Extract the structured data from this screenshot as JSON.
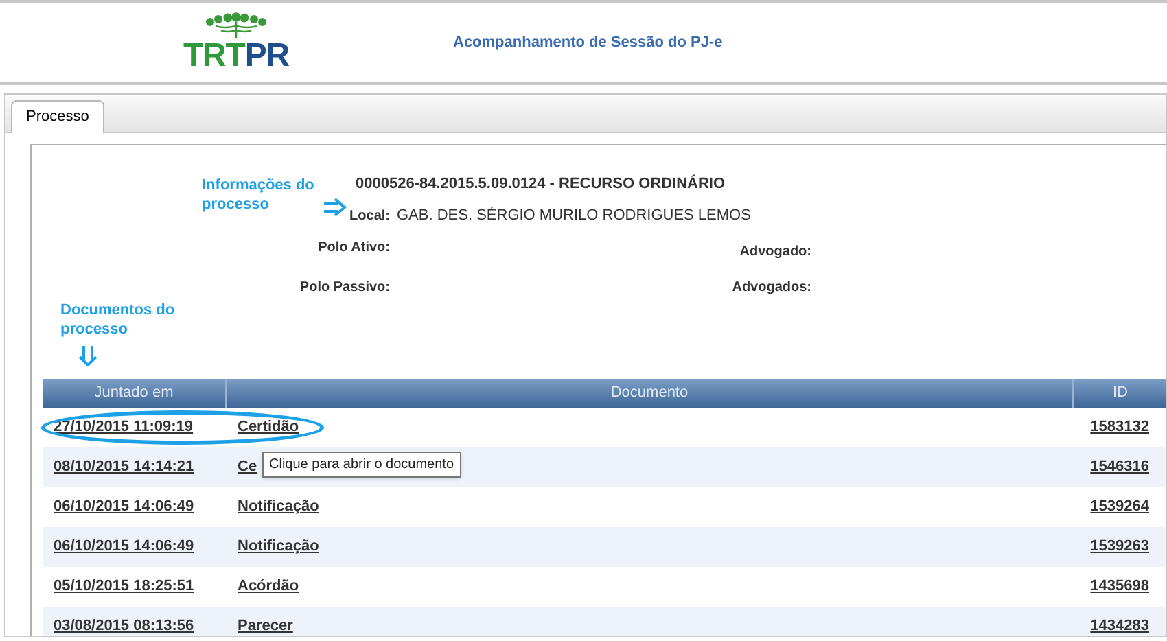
{
  "header": {
    "logo": [
      "TRT",
      "PR"
    ],
    "title": "Acompanhamento de Sessão do PJ-e"
  },
  "tabs": [
    {
      "label": "Processo",
      "selected": true
    }
  ],
  "process": {
    "title": "0000526-84.2015.5.09.0124 - RECURSO ORDINÁRIO",
    "fields": [
      {
        "label": "Local:",
        "value": "GAB. DES. SÉRGIO MURILO RODRIGUES LEMOS"
      }
    ],
    "parties": [
      {
        "label": "Polo Ativo:",
        "lawyer_label": "Advogado:"
      },
      {
        "label": "Polo Passivo:",
        "lawyer_label": "Advogados:"
      }
    ]
  },
  "annotations": [
    {
      "text": "Informações do processo",
      "kind": "right"
    },
    {
      "text": "Documentos do processo",
      "kind": "down"
    }
  ],
  "table": {
    "columns": [
      "Juntado em",
      "Documento",
      "ID"
    ],
    "rows": [
      {
        "date": "27/10/2015 11:09:19",
        "document": "Certidão",
        "id": "1583132",
        "circled": true
      },
      {
        "date": "08/10/2015 14:14:21",
        "document": "Ce",
        "id": "1546316",
        "circled": false,
        "tooltip": "Clique para abrir o documento"
      },
      {
        "date": "06/10/2015 14:06:49",
        "document": "Notificação",
        "id": "1539264",
        "circled": false
      },
      {
        "date": "06/10/2015 14:06:49",
        "document": "Notificação",
        "id": "1539263",
        "circled": false
      },
      {
        "date": "05/10/2015 18:25:51",
        "document": "Acórdão",
        "id": "1435698",
        "circled": false
      },
      {
        "date": "03/08/2015 08:13:56",
        "document": "Parecer",
        "id": "1434283",
        "circled": false
      }
    ]
  }
}
